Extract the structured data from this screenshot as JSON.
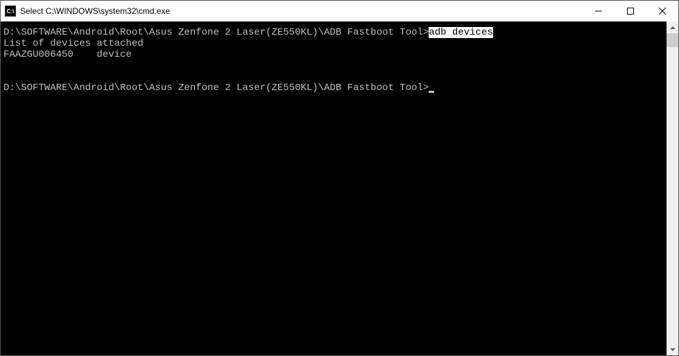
{
  "titlebar": {
    "icon_text": "C:\\",
    "title": "Select C:\\WINDOWS\\system32\\cmd.exe"
  },
  "terminal": {
    "prompt1_path": "D:\\SOFTWARE\\Android\\Root\\Asus Zenfone 2 Laser(ZE550KL)\\ADB Fastboot Tool>",
    "prompt1_cmd_selected": "adb devices",
    "output_line1": "List of devices attached",
    "output_line2": "FAAZGU006450    device",
    "prompt2_path": "D:\\SOFTWARE\\Android\\Root\\Asus Zenfone 2 Laser(ZE550KL)\\ADB Fastboot Tool>"
  }
}
